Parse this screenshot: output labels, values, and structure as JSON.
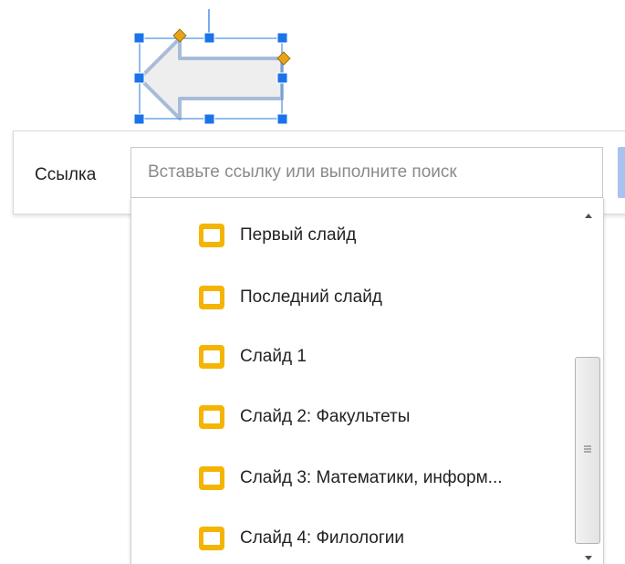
{
  "link_popup": {
    "label": "Ссылка",
    "input_value": "",
    "input_placeholder": "Вставьте ссылку или выполните поиск"
  },
  "dropdown": {
    "items": [
      {
        "label": "Первый слайд",
        "icon": "slide-icon"
      },
      {
        "label": "Последний слайд",
        "icon": "slide-icon"
      },
      {
        "label": "Слайд 1",
        "icon": "slide-icon"
      },
      {
        "label": "Слайд 2: Факультеты",
        "icon": "slide-icon"
      },
      {
        "label": "Слайд 3: Математики, информ...",
        "icon": "slide-icon"
      },
      {
        "label": "Слайд 4: Филологии",
        "icon": "slide-icon"
      }
    ]
  },
  "colors": {
    "selection_handle": "#1a73e8",
    "adjust_handle": "#e8a317",
    "shape_fill": "#eeeeee",
    "shape_stroke": "#9fb7d6",
    "slide_icon": "#f4b400",
    "apply_button": "#a8c3f0"
  }
}
